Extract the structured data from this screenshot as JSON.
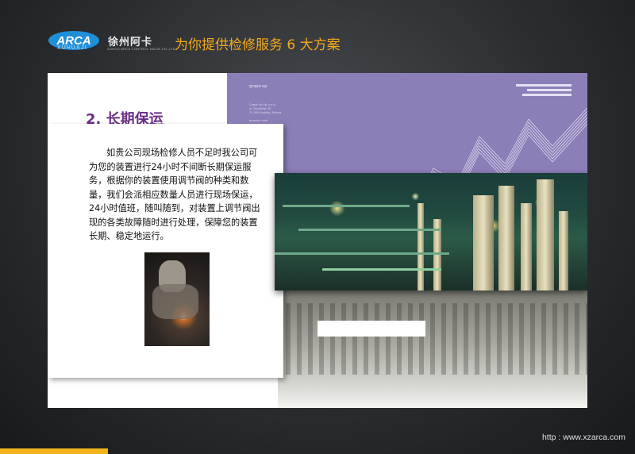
{
  "header": {
    "logo_text": "ARCA",
    "logo_sub": "XUHUAJI",
    "brand_cn": "徐州阿卡",
    "brand_sub": "XUHOU ARCA CONTROL VALVE CO.,LTD.",
    "title": "为你提供检修服务 6 大方案"
  },
  "slide": {
    "heading": "2. 长期保运",
    "body": "如贵公司现场检修人员不足时我公司可为您的装置进行24小时不间断长期保运服务，根据你的装置使用调节阀的种类和数量，我们会派相应数量人员进行现场保运，24小时值班，随叫随到，对装置上调节阀出现的各类故障随时进行处理，保障您的装置长期、稳定地运行。",
    "brochure_brand": "grape·up",
    "brochure_address": "Grape Up Sp. z o.o.\nul. Skrzatów 20\n31-000 Kraków, Poland",
    "brochure_web": "grapeup.com"
  },
  "footer": {
    "url": "http :  www.xzarca.com"
  },
  "colors": {
    "accent_title": "#f2a81d",
    "heading": "#6a2f86",
    "purple": "#8c7fb8",
    "logo_blue": "#1f8fd8",
    "footer_bar": "#f0b41a"
  }
}
